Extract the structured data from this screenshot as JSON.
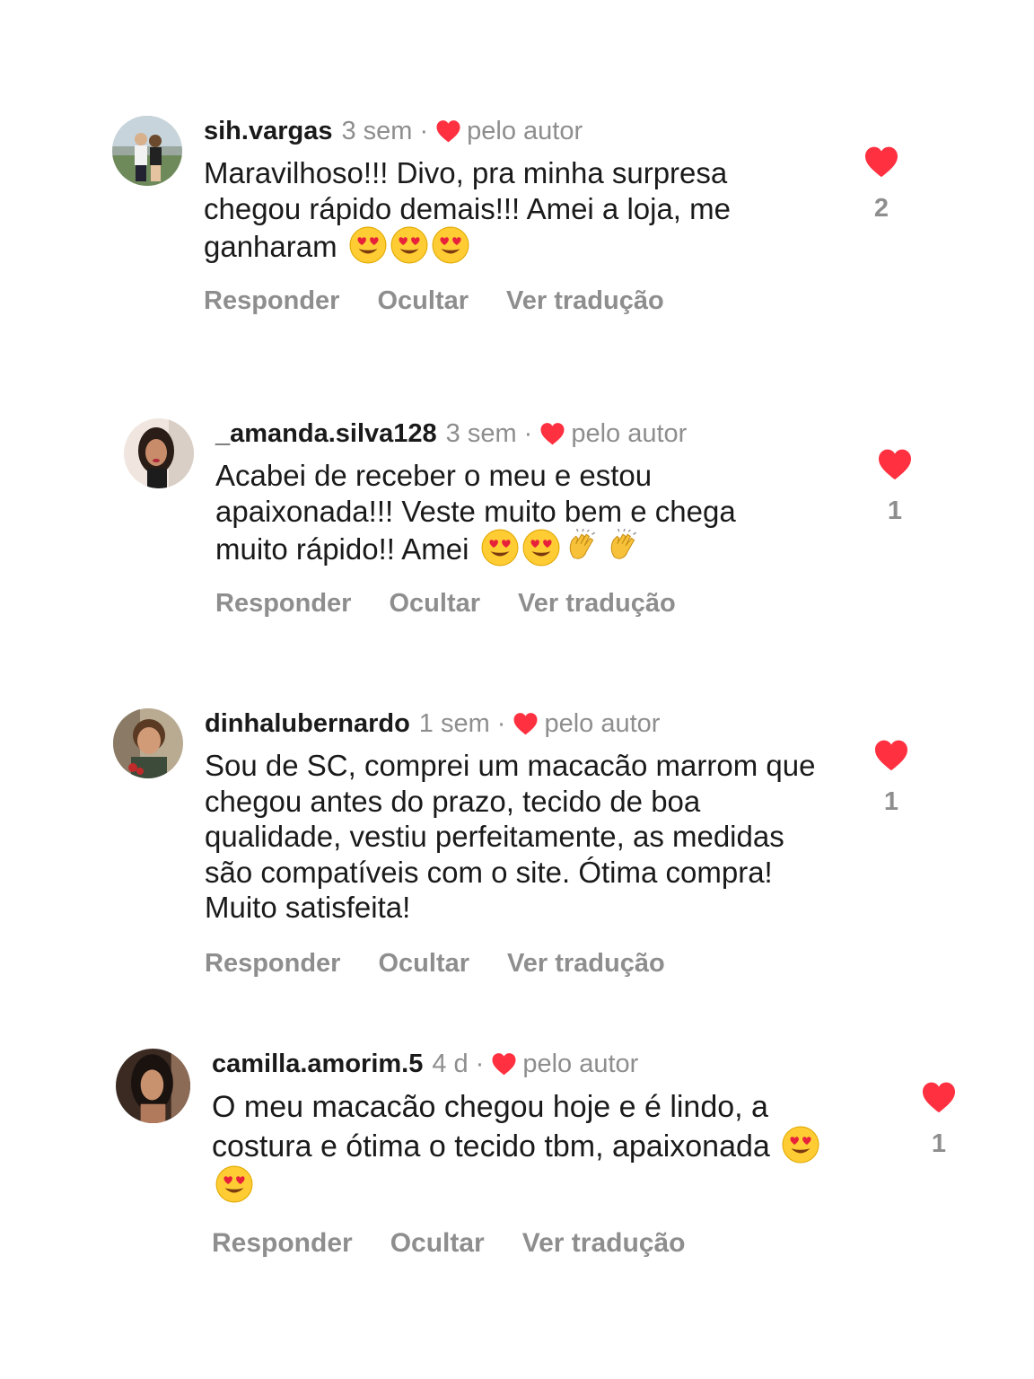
{
  "theme": {
    "heart_color": "#ff3040",
    "muted": "#8e8e8e",
    "text": "#1a1a1a"
  },
  "labels": {
    "author_liked": "pelo autor",
    "separator": "·"
  },
  "actions": {
    "reply": "Responder",
    "hide": "Ocultar",
    "translate": "Ver tradução"
  },
  "comments": [
    {
      "username": "sih.vargas",
      "time": "3 sem",
      "text": "Maravilhoso!!! Divo, pra minha surpresa chegou rápido demais!!! Amei a loja, me ganharam",
      "emojis": [
        "heart-eyes-emoji",
        "heart-eyes-emoji",
        "heart-eyes-emoji"
      ],
      "likes": "2"
    },
    {
      "username": "_amanda.silva128",
      "time": "3 sem",
      "text": "Acabei de receber o meu e estou apaixonada!!! Veste muito bem e chega muito rápido!! Amei",
      "emojis": [
        "heart-eyes-emoji",
        "heart-eyes-emoji",
        "clapping-hands-emoji",
        "clapping-hands-emoji"
      ],
      "likes": "1"
    },
    {
      "username": "dinhalubernardo",
      "time": "1 sem",
      "text": "Sou de SC, comprei um macacão marrom que chegou antes do prazo, tecido de boa qualidade, vestiu perfeitamente, as medidas são compatíveis com o site. Ótima compra! Muito satisfeita!",
      "emojis": [],
      "likes": "1"
    },
    {
      "username": "camilla.amorim.5",
      "time": "4 d",
      "text": "O meu macacão chegou hoje e é lindo, a costura e ótima o tecido tbm, apaixonada",
      "emojis": [
        "heart-eyes-emoji",
        "heart-eyes-emoji"
      ],
      "likes": "1"
    }
  ]
}
